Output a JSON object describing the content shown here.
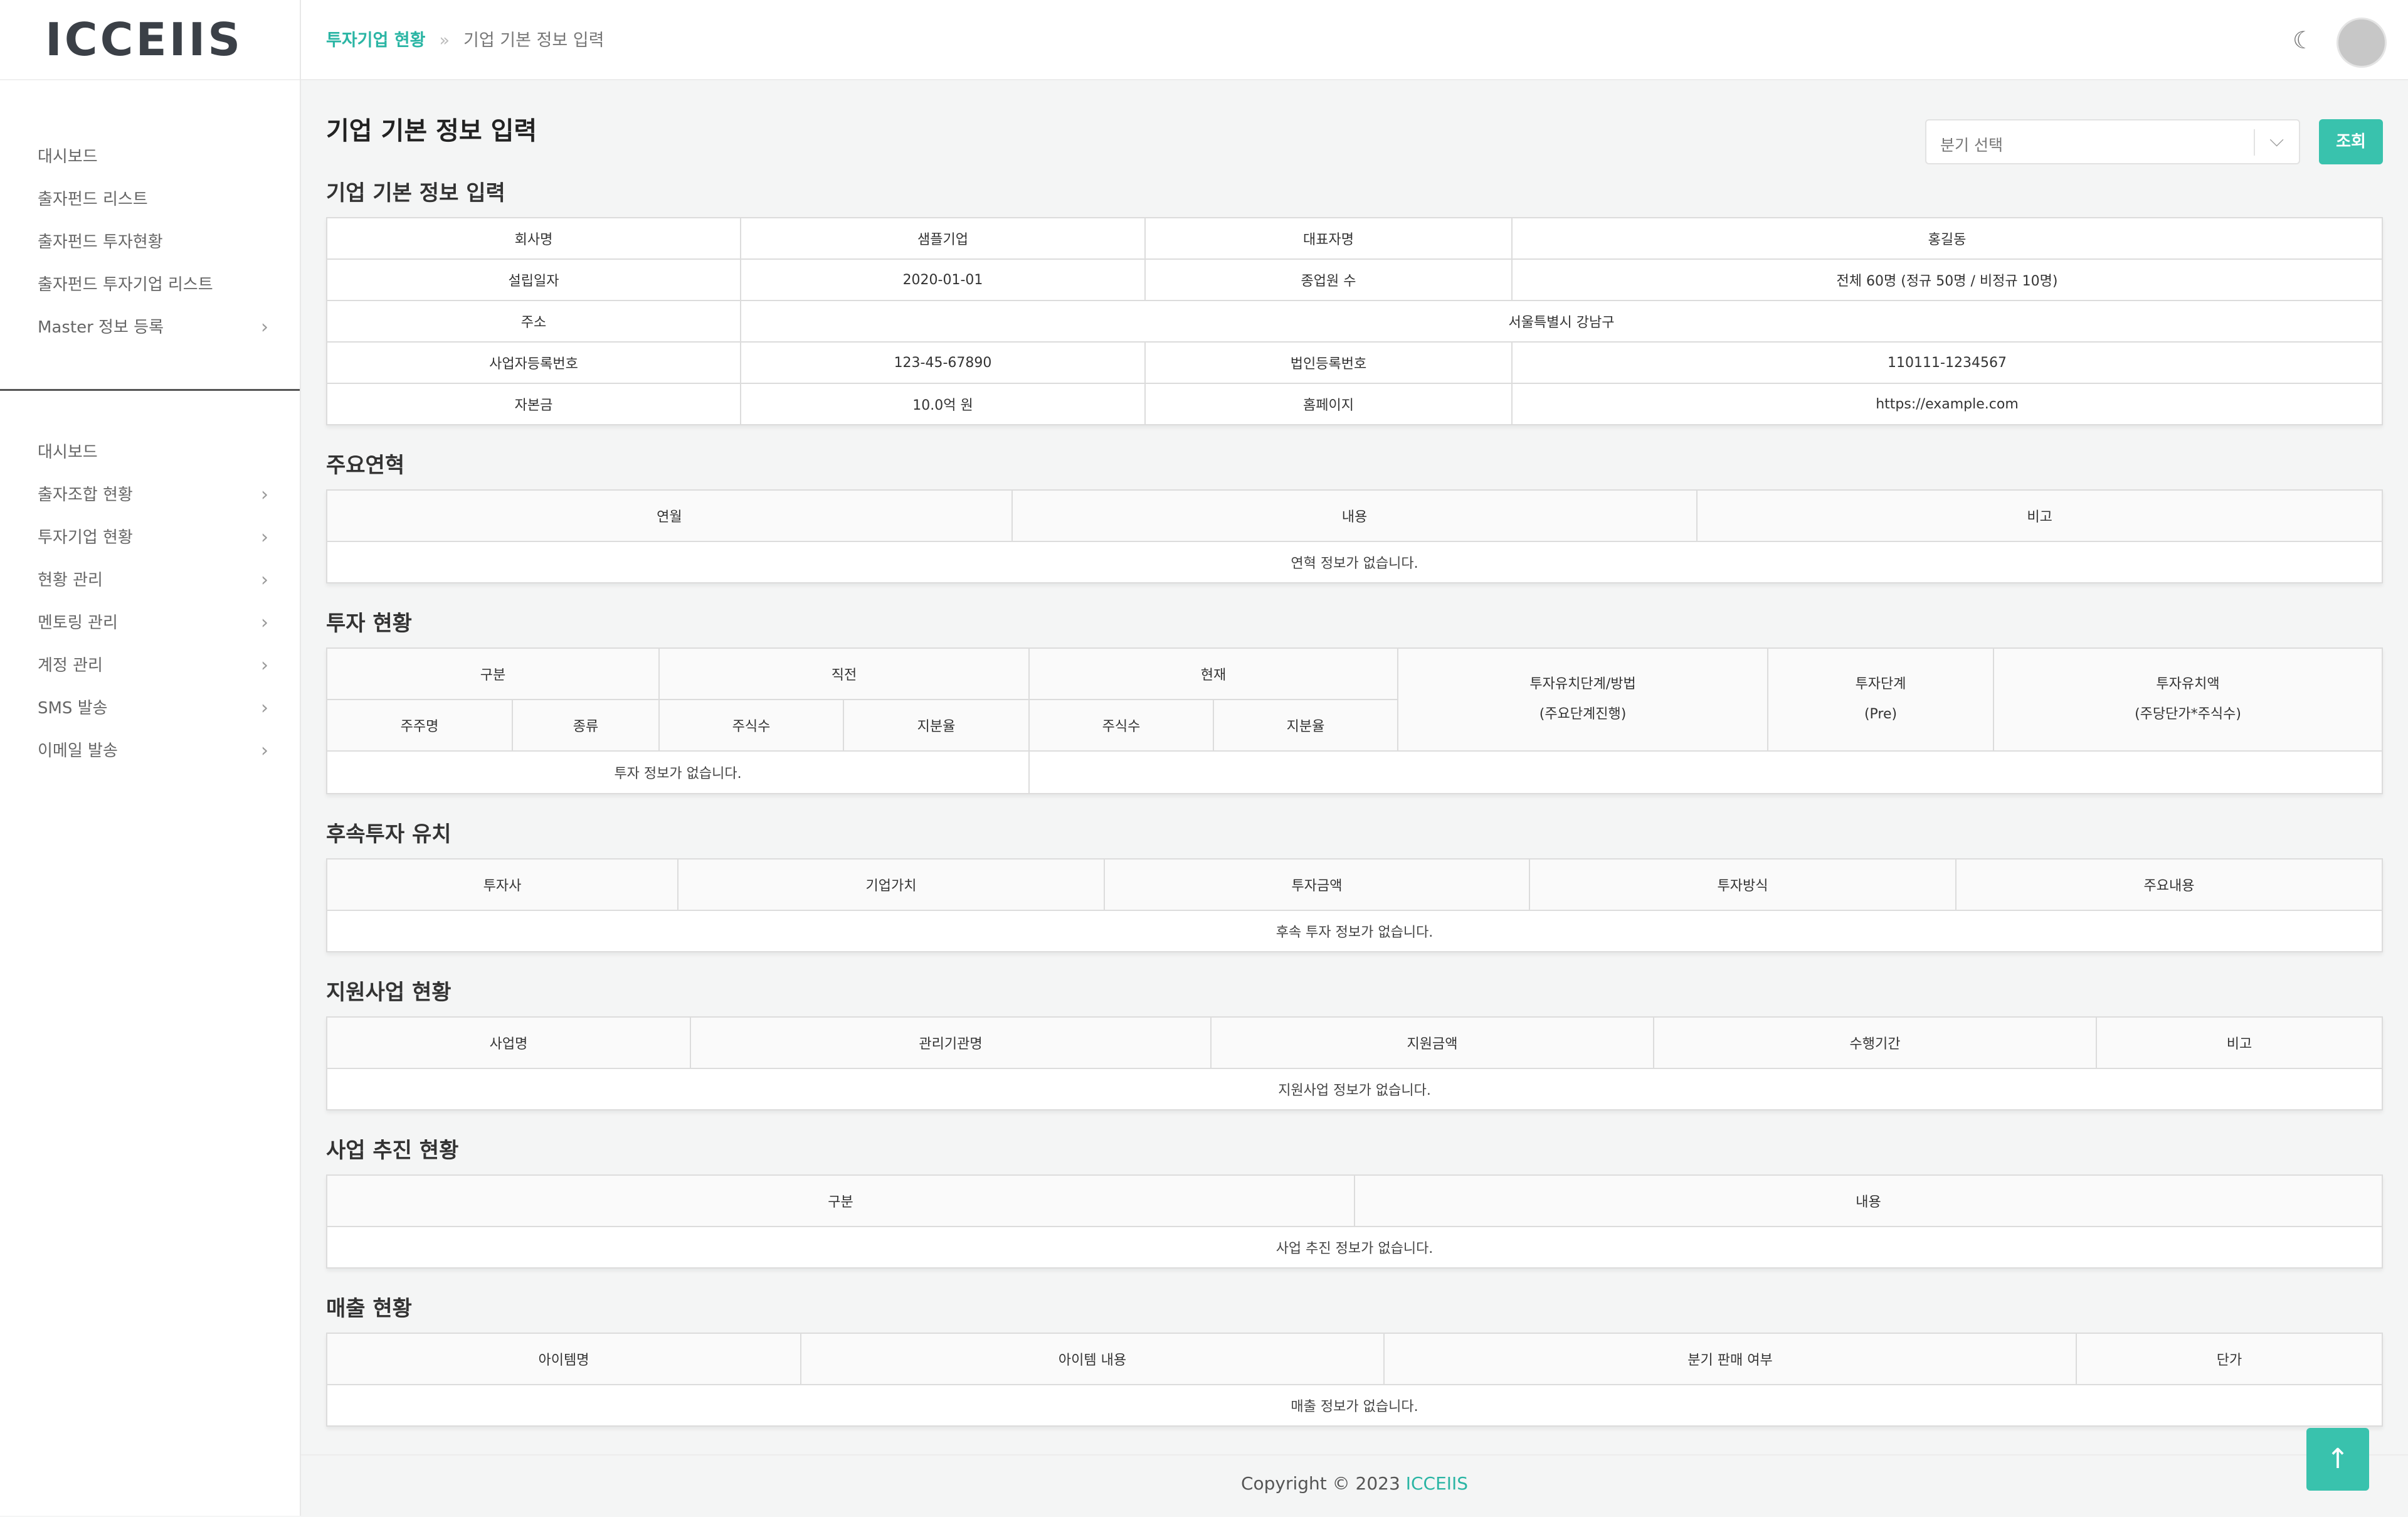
{
  "app": {
    "logo": "ICCEIIS"
  },
  "sidebar": {
    "group1": [
      {
        "label": "대시보드",
        "chevron": false
      },
      {
        "label": "출자펀드 리스트",
        "chevron": false
      },
      {
        "label": "출자펀드 투자현황",
        "chevron": false
      },
      {
        "label": "출자펀드 투자기업 리스트",
        "chevron": false
      },
      {
        "label": "Master 정보 등록",
        "chevron": true
      }
    ],
    "group2": [
      {
        "label": "대시보드",
        "chevron": false
      },
      {
        "label": "출자조합 현황",
        "chevron": true
      },
      {
        "label": "투자기업 현황",
        "chevron": true
      },
      {
        "label": "현황 관리",
        "chevron": true
      },
      {
        "label": "멘토링 관리",
        "chevron": true
      },
      {
        "label": "계정 관리",
        "chevron": true
      },
      {
        "label": "SMS 발송",
        "chevron": true
      },
      {
        "label": "이메일 발송",
        "chevron": true
      }
    ],
    "chevron_glyph": "›"
  },
  "header": {
    "breadcrumb_active": "투자기업 현황",
    "breadcrumb_sep": "»",
    "breadcrumb_current": "기업 기본 정보 입력",
    "theme_icon": "moon-icon",
    "theme_glyph": "☾"
  },
  "page": {
    "title": "기업 기본 정보 입력",
    "quarter_select_placeholder": "분기 선택",
    "select_chevron": "⌵",
    "search_button": "조회"
  },
  "basic_info": {
    "title": "기업 기본 정보 입력",
    "rows": [
      [
        "회사명",
        "샘플기업",
        "대표자명",
        "홍길동"
      ],
      [
        "설립일자",
        "2020-01-01",
        "종업원 수",
        "전체 60명 (정규 50명 / 비정규 10명)"
      ],
      [
        "주소",
        "서울특별시 강남구"
      ],
      [
        "사업자등록번호",
        "123-45-67890",
        "법인등록번호",
        "110111-1234567"
      ],
      [
        "자본금",
        "10.0억 원",
        "홈페이지",
        "https://example.com"
      ]
    ]
  },
  "history": {
    "title": "주요연혁",
    "headers": [
      "연월",
      "내용",
      "비고"
    ],
    "empty": "연혁 정보가 없습니다."
  },
  "investment": {
    "title": "투자 현황",
    "headers_top": [
      "구분",
      "직전",
      "현재",
      "투자유치단계/방법",
      "투자단계",
      "투자유치액"
    ],
    "headers_top_sub": [
      "(주요단계진행)",
      "(Pre)",
      "(주당단가*주식수)"
    ],
    "headers_sub": [
      "주주명",
      "종류",
      "주식수",
      "지분율",
      "주식수",
      "지분율"
    ],
    "empty": "투자 정보가 없습니다."
  },
  "followup": {
    "title": "후속투자 유치",
    "headers": [
      "투자사",
      "기업가치",
      "투자금액",
      "투자방식",
      "주요내용"
    ],
    "empty": "후속 투자 정보가 없습니다."
  },
  "support": {
    "title": "지원사업 현황",
    "headers": [
      "사업명",
      "관리기관명",
      "지원금액",
      "수행기간",
      "비고"
    ],
    "empty": "지원사업 정보가 없습니다."
  },
  "progress": {
    "title": "사업 추진 현황",
    "headers": [
      "구분",
      "내용"
    ],
    "empty": "사업 추진 정보가 없습니다."
  },
  "sales": {
    "title": "매출 현황",
    "headers": [
      "아이템명",
      "아이템 내용",
      "분기 판매 여부",
      "단가"
    ],
    "empty": "매출 정보가 없습니다."
  },
  "footer": {
    "prefix": "Copyright © 2023 ",
    "brand": "ICCEIIS"
  },
  "scroll_top": {
    "glyph": "↑",
    "icon": "arrow-up-icon"
  },
  "colors": {
    "accent": "#39c2ad",
    "accent_text": "#2ab5a4"
  }
}
